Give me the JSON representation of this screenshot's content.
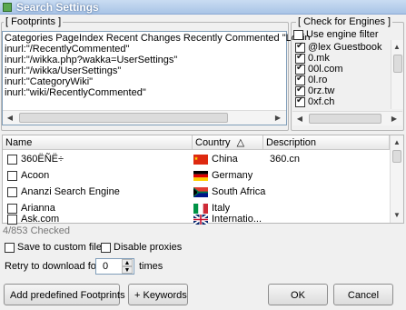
{
  "window": {
    "title": "Search Settings"
  },
  "footprints": {
    "group_label": "[ Footprints ]",
    "lines": [
      "Categories PageIndex Recent Changes Recently Commented \"Login",
      "inurl:\"/RecentlyCommented\"",
      "inurl:\"/wikka.php?wakka=UserSettings\"",
      "inurl:\"/wikka/UserSettings\"",
      "inurl:\"CategoryWiki\"",
      "inurl:\"wiki/RecentlyCommented\""
    ]
  },
  "engines_filter": {
    "group_label": "[ Check for Engines ]",
    "use_filter_label": "Use engine filter",
    "use_filter_checked": false,
    "items": [
      {
        "label": "@lex Guestbook",
        "checked": true
      },
      {
        "label": "0.mk",
        "checked": true
      },
      {
        "label": "00l.com",
        "checked": true
      },
      {
        "label": "0l.ro",
        "checked": true
      },
      {
        "label": "0rz.tw",
        "checked": true
      },
      {
        "label": "0xf.ch",
        "checked": true
      }
    ]
  },
  "engines_table": {
    "columns": {
      "name": "Name",
      "country": "Country",
      "description": "Description"
    },
    "sort_indicator": "△",
    "rows": [
      {
        "name": "360ËÑË÷",
        "country": "China",
        "flag": "china",
        "description": "360.cn",
        "checked": false
      },
      {
        "name": "Acoon",
        "country": "Germany",
        "flag": "germany",
        "description": "",
        "checked": false
      },
      {
        "name": "Ananzi Search Engine",
        "country": "South Africa",
        "flag": "south-africa",
        "description": "",
        "checked": false
      },
      {
        "name": "Arianna",
        "country": "Italy",
        "flag": "italy",
        "description": "",
        "checked": false
      },
      {
        "name": "Ask.com",
        "country": "Internatio...",
        "flag": "international",
        "description": "",
        "checked": false
      }
    ]
  },
  "status": {
    "checked_count": "4/853 Checked"
  },
  "options": {
    "save_custom_label": "Save to custom file",
    "save_custom_checked": false,
    "disable_proxies_label": "Disable proxies",
    "disable_proxies_checked": false,
    "retry_label": "Retry to download for",
    "retry_value": "0",
    "retry_unit": "times"
  },
  "buttons": {
    "add_predefined": "Add predefined Footprints",
    "keywords": "+ Keywords",
    "ok": "OK",
    "cancel": "Cancel"
  }
}
